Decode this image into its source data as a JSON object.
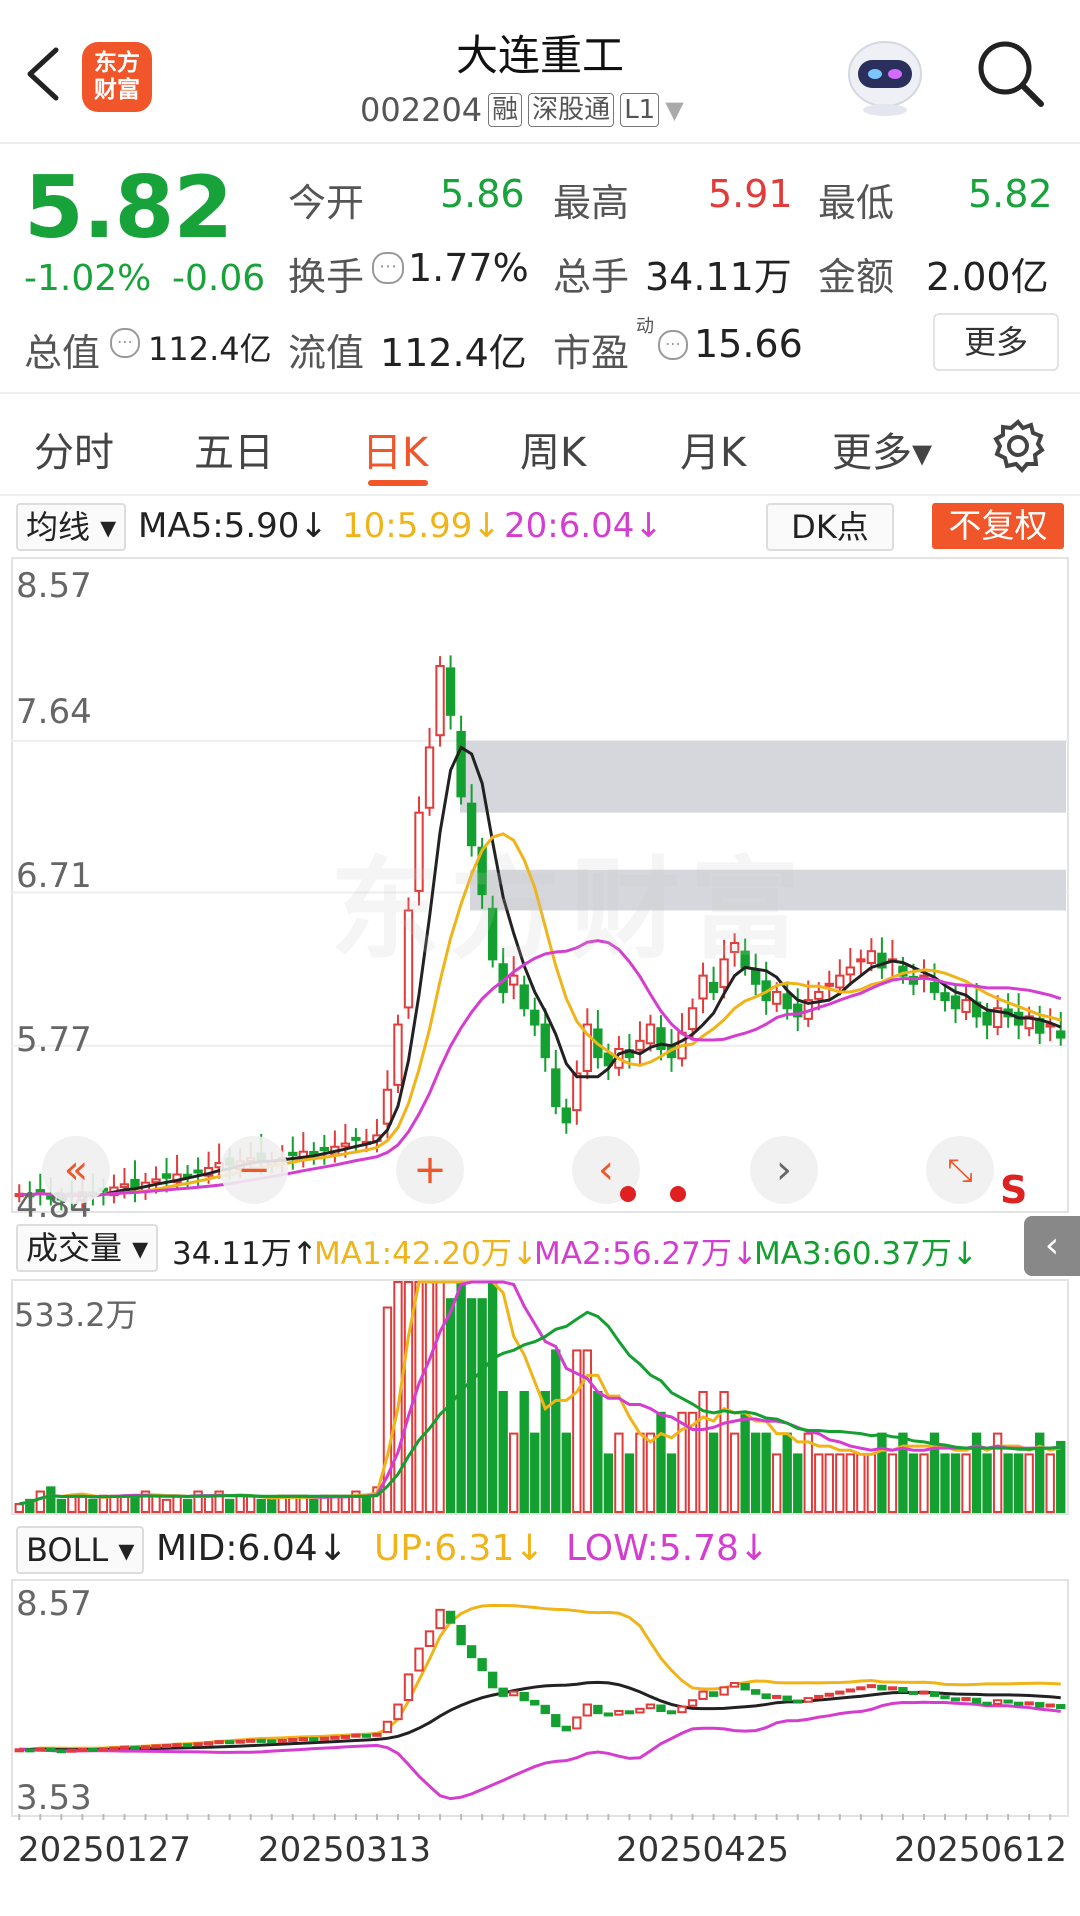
{
  "header": {
    "back_icon": "chevron-left-icon",
    "logo_line1": "东方",
    "logo_line2": "财富",
    "title": "大连重工",
    "code": "002204",
    "tags": [
      "融",
      "深股通",
      "L1"
    ]
  },
  "quote": {
    "price": "5.82",
    "change_pct": "-1.02%",
    "change_abs": "-0.06",
    "open_label": "今开",
    "open_value": "5.86",
    "high_label": "最高",
    "high_value": "5.91",
    "low_label": "最低",
    "low_value": "5.82",
    "turnover_label": "换手",
    "turnover_value": "1.77%",
    "volume_label": "总手",
    "volume_value": "34.11万",
    "amount_label": "金额",
    "amount_value": "2.00亿",
    "mktcap_label": "总值",
    "mktcap_value": "112.4亿",
    "float_label": "流值",
    "float_value": "112.4亿",
    "pe_label": "市盈",
    "pe_sup": "动",
    "pe_value": "15.66",
    "more_button": "更多"
  },
  "tabs": [
    {
      "label": "分时",
      "active": false
    },
    {
      "label": "五日",
      "active": false
    },
    {
      "label": "日K",
      "active": true
    },
    {
      "label": "周K",
      "active": false
    },
    {
      "label": "月K",
      "active": false
    },
    {
      "label": "更多▾",
      "active": false
    }
  ],
  "ma_bar": {
    "dropdown": "均线 ▾",
    "ma5": "MA5:5.90↓",
    "ma10": "10:5.99↓",
    "ma20": "20:6.04↓",
    "dk_button": "DK点",
    "fq_button": "不复权"
  },
  "price_axis": [
    "8.57",
    "7.64",
    "6.71",
    "5.77",
    "4.84"
  ],
  "watermark": "东方财富",
  "s_marker": "S",
  "vol_bar": {
    "dropdown": "成交量 ▾",
    "vol": "34.11万↑",
    "ma1": "MA1:42.20万↓",
    "ma2": "MA2:56.27万↓",
    "ma3": "MA3:60.37万↓",
    "max_label": "533.2万"
  },
  "boll_bar": {
    "dropdown": "BOLL ▾",
    "mid": "MID:6.04↓",
    "up": "UP:6.31↓",
    "low": "LOW:5.78↓",
    "top_label": "8.57",
    "bottom_label": "3.53"
  },
  "dates": [
    "20250127",
    "20250313",
    "20250425",
    "20250612"
  ],
  "colors": {
    "up": "#e23b3b",
    "down": "#14a030",
    "ma5": "#222222",
    "ma10": "#f0b419",
    "ma20": "#d43dd0",
    "accent": "#f0562a"
  },
  "chart_data": {
    "type": "candlestick",
    "series_close": [
      4.86,
      4.85,
      4.88,
      4.84,
      4.83,
      4.85,
      4.87,
      4.86,
      4.88,
      4.9,
      4.92,
      4.9,
      4.93,
      4.95,
      4.96,
      4.98,
      4.97,
      5.0,
      5.02,
      5.05,
      5.04,
      5.06,
      5.08,
      5.07,
      5.06,
      5.08,
      5.1,
      5.12,
      5.11,
      5.13,
      5.15,
      5.17,
      5.2,
      5.18,
      5.22,
      5.5,
      5.9,
      6.6,
      7.2,
      7.6,
      8.1,
      7.8,
      7.3,
      7.0,
      6.7,
      6.3,
      6.1,
      6.2,
      6.0,
      5.9,
      5.7,
      5.4,
      5.3,
      5.6,
      5.9,
      5.7,
      5.65,
      5.75,
      5.7,
      5.8,
      5.9,
      5.75,
      5.7,
      5.85,
      6.0,
      6.2,
      6.1,
      6.3,
      6.4,
      6.25,
      6.15,
      6.05,
      6.1,
      6.0,
      5.95,
      6.05,
      6.1,
      6.15,
      6.2,
      6.25,
      6.3,
      6.35,
      6.25,
      6.3,
      6.2,
      6.15,
      6.2,
      6.1,
      6.05,
      6.0,
      6.05,
      5.95,
      5.9,
      6.0,
      5.95,
      5.9,
      5.95,
      5.85,
      5.9,
      5.82
    ]
  }
}
